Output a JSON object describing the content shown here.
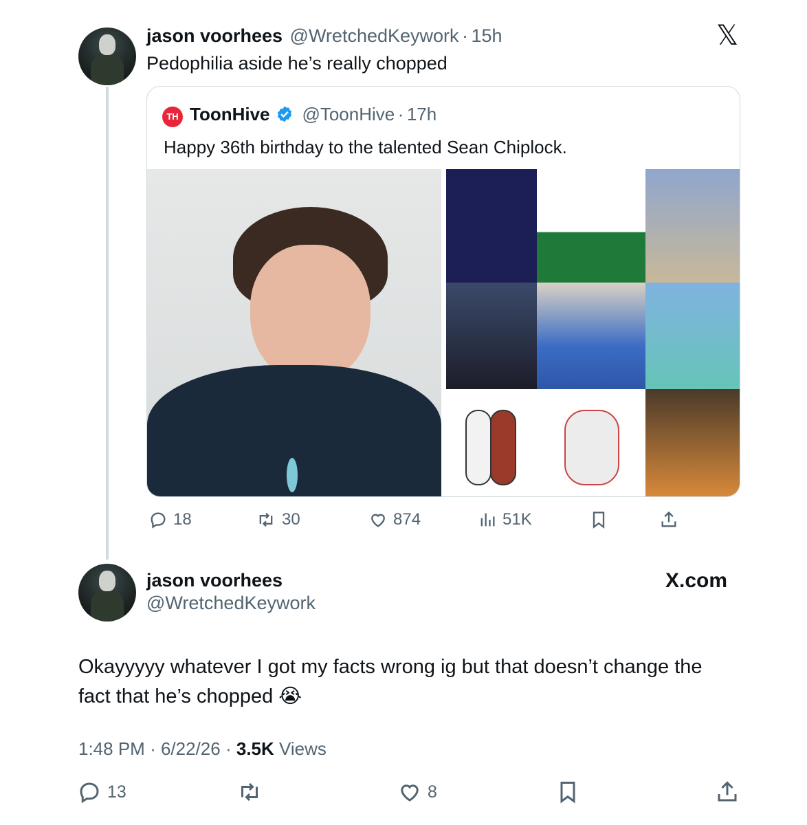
{
  "tweet1": {
    "name": "jason voorhees",
    "handle": "@WretchedKeywork",
    "time": "15h",
    "sep": "·",
    "text": "Pedophilia aside he’s really chopped"
  },
  "quote": {
    "logo_text": "TH",
    "name": "ToonHive",
    "handle": "@ToonHive",
    "time": "17h",
    "sep": "·",
    "text": "Happy 36th birthday to the talented Sean Chiplock."
  },
  "tweet1_actions": {
    "replies": "18",
    "reposts": "30",
    "likes": "874",
    "views": "51K"
  },
  "tweet2": {
    "name": "jason voorhees",
    "handle": "@WretchedKeywork",
    "brand": "X.com",
    "text_line1": "Okayyyyy whatever I got my facts wrong ig but that doesn’t change the",
    "text_line2": "fact that he’s chopped",
    "emoji": "😭",
    "time": "1:48 PM",
    "date": "6/22/26",
    "views_count": "3.5K",
    "views_label": "Views",
    "sep": "·"
  },
  "tweet2_actions": {
    "replies": "13",
    "likes": "8"
  },
  "icons": {
    "x_logo": "𝕏",
    "reply": "reply-icon",
    "repost": "repost-icon",
    "like": "heart-icon",
    "views": "views-icon",
    "bookmark": "bookmark-icon",
    "share": "share-icon"
  },
  "colors": {
    "text": "#0f1419",
    "muted": "#536471",
    "border": "#cfd9de",
    "verified": "#1d9bf0",
    "toonhive": "#e8263a"
  }
}
